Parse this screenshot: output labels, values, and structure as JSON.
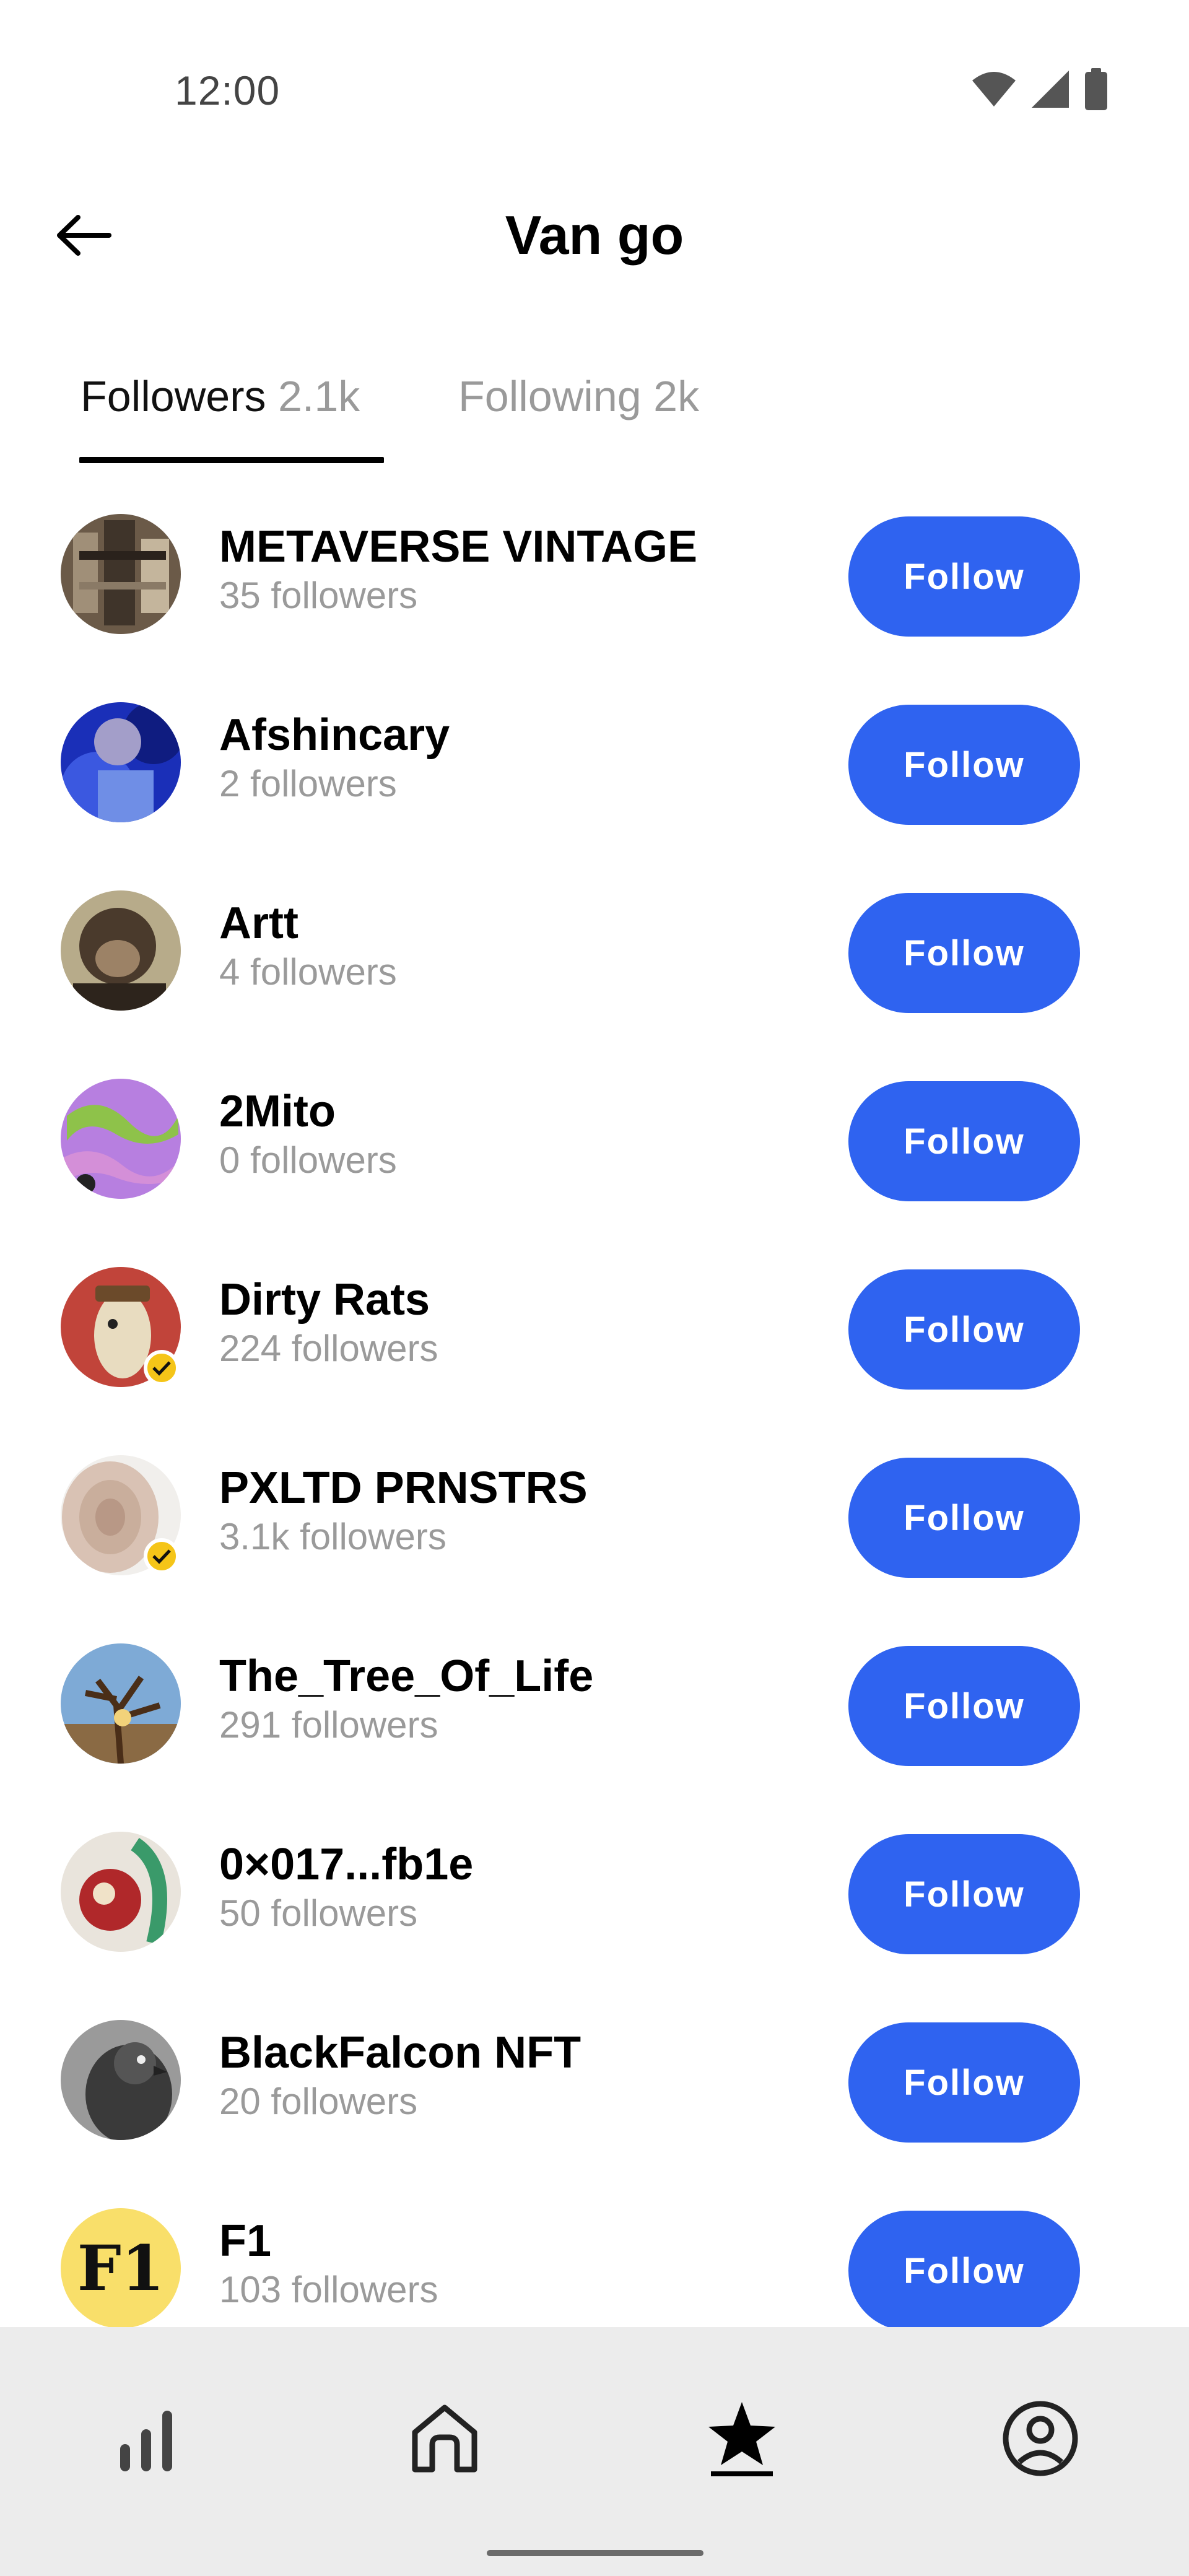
{
  "status_bar": {
    "time": "12:00",
    "icons": [
      "wifi-icon",
      "signal-icon",
      "battery-icon"
    ]
  },
  "header": {
    "title": "Van go",
    "back_icon": "arrow-left-icon"
  },
  "tabs": [
    {
      "label": "Followers",
      "count": "2.1k",
      "active": true
    },
    {
      "label": "Following",
      "count": "2k",
      "active": false
    }
  ],
  "colors": {
    "accent": "#2f63f0",
    "muted_text": "#9a9a9a",
    "verified": "#f5c518",
    "nav_bg": "#ececec"
  },
  "followers": [
    {
      "name": "METAVERSE VINTAGE",
      "followers": "35 followers",
      "button": "Follow",
      "verified": false
    },
    {
      "name": "Afshincary",
      "followers": "2 followers",
      "button": "Follow",
      "verified": false
    },
    {
      "name": "Artt",
      "followers": "4 followers",
      "button": "Follow",
      "verified": false
    },
    {
      "name": "2Mito",
      "followers": "0 followers",
      "button": "Follow",
      "verified": false
    },
    {
      "name": "Dirty Rats",
      "followers": "224 followers",
      "button": "Follow",
      "verified": true
    },
    {
      "name": "PXLTD PRNSTRS",
      "followers": "3.1k followers",
      "button": "Follow",
      "verified": true
    },
    {
      "name": "The_Tree_Of_Life",
      "followers": "291 followers",
      "button": "Follow",
      "verified": false
    },
    {
      "name": "0×017...fb1e",
      "followers": "50 followers",
      "button": "Follow",
      "verified": false
    },
    {
      "name": "BlackFalcon NFT",
      "followers": "20 followers",
      "button": "Follow",
      "verified": false
    },
    {
      "name": "F1",
      "followers": "103 followers",
      "button": "Follow",
      "verified": false,
      "avatar_text": "F1"
    }
  ],
  "bottom_nav": [
    {
      "icon": "bar-chart-icon",
      "active": false
    },
    {
      "icon": "home-icon",
      "active": false
    },
    {
      "icon": "star-icon",
      "active": true
    },
    {
      "icon": "profile-icon",
      "active": false
    }
  ]
}
